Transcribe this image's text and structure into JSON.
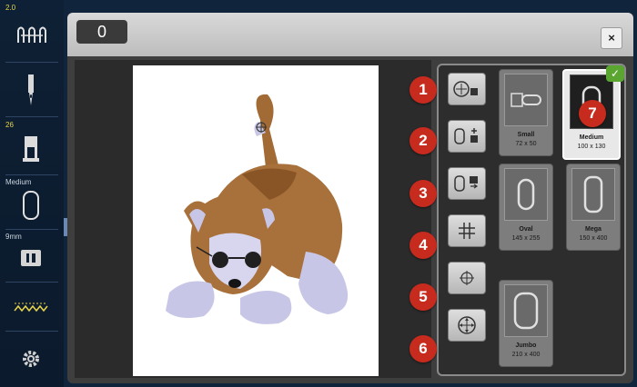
{
  "sidebar": {
    "stitch_width": "2.0",
    "presser_foot": "26",
    "hoop_label": "Medium",
    "bobbin_label": "9mm"
  },
  "title_tab": "0",
  "close_label": "×",
  "tool_buttons": [
    {
      "icon": "hoop-center-icon"
    },
    {
      "icon": "hoop-rotate-icon"
    },
    {
      "icon": "hoop-move-icon"
    },
    {
      "icon": "grid-icon"
    },
    {
      "icon": "crosshair-icon"
    },
    {
      "icon": "center-move-icon"
    }
  ],
  "hoops": [
    {
      "name": "Small",
      "size": "72 x 50"
    },
    {
      "name": "Medium",
      "size": "100 x 130",
      "selected": true
    },
    {
      "name": "Oval",
      "size": "145 x 255"
    },
    {
      "name": "Mega",
      "size": "150 x 400"
    },
    {
      "name": "Jumbo",
      "size": "210 x 400"
    }
  ],
  "badges": [
    "1",
    "2",
    "3",
    "4",
    "5",
    "6",
    "7"
  ],
  "check_mark": "✓",
  "colors": {
    "badge": "#c62b1e",
    "check": "#5aa631",
    "accent_yellow": "#e8d44a"
  }
}
